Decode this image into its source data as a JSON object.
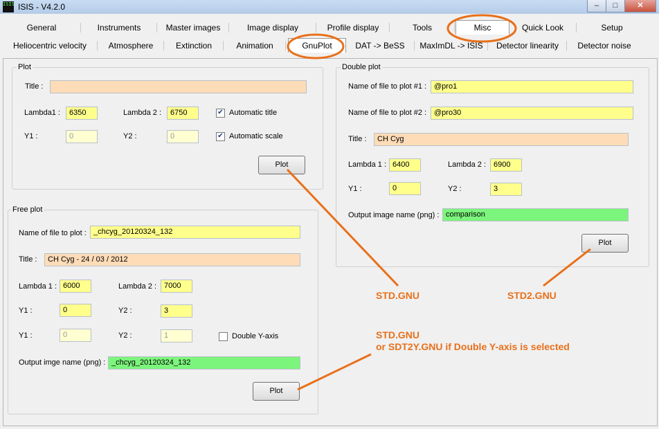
{
  "window": {
    "title": "ISIS - V4.2.0",
    "app_icon": "ISIS",
    "controls": [
      "–",
      "□",
      "✕"
    ]
  },
  "tabs_row1": [
    "General",
    "Instruments",
    "Master images",
    "Image display",
    "Profile display",
    "Tools",
    "Misc",
    "Quick Look",
    "Setup"
  ],
  "tabs_row2": [
    "Heliocentric velocity",
    "Atmosphere",
    "Extinction",
    "Animation",
    "GnuPlot",
    "DAT -> BeSS",
    "MaxImDL -> ISIS",
    "Detector linearity",
    "Detector noise"
  ],
  "plot": {
    "group": "Plot",
    "title_label": "Title :",
    "title_value": "",
    "lambda1_label": "Lambda1 :",
    "lambda1": "6350",
    "lambda2_label": "Lambda 2 :",
    "lambda2": "6750",
    "auto_title_label": "Automatic title",
    "y1_label": "Y1 :",
    "y1": "0",
    "y2_label": "Y2 :",
    "y2": "0",
    "auto_scale_label": "Automatic scale",
    "plot_button": "Plot"
  },
  "free_plot": {
    "group": "Free plot",
    "file_label": "Name of file to plot :",
    "file": "_chcyg_20120324_132",
    "title_label": "Title :",
    "title": "CH Cyg - 24 / 03 / 2012",
    "lambda1_label": "Lambda 1 :",
    "lambda1": "6000",
    "lambda2_label": "Lambda 2 :",
    "lambda2": "7000",
    "y1_label": "Y1 :",
    "y1": "0",
    "y2_label": "Y2 :",
    "y2": "3",
    "y1b_label": "Y1 :",
    "y1b": "0",
    "y2b_label": "Y2 :",
    "y2b": "1",
    "double_y_label": "Double Y-axis",
    "output_label": "Output imge name (png) :",
    "output": "_chcyg_20120324_132",
    "plot_button": "Plot"
  },
  "double_plot": {
    "group": "Double plot",
    "file1_label": "Name of file to plot #1 :",
    "file1": "@pro1",
    "file2_label": "Name of file to plot #2 :",
    "file2": "@pro30",
    "title_label": "Title :",
    "title": "CH Cyg",
    "lambda1_label": "Lambda 1 :",
    "lambda1": "6400",
    "lambda2_label": "Lambda 2 :",
    "lambda2": "6900",
    "y1_label": "Y1 :",
    "y1": "0",
    "y2_label": "Y2 :",
    "y2": "3",
    "output_label": "Output image name (png) :",
    "output": "comparison",
    "plot_button": "Plot"
  },
  "annotations": {
    "std": "STD.GNU",
    "std2": "STD2.GNU",
    "free_line1": "STD.GNU",
    "free_line2": "or SDT2Y.GNU if Double Y-axis is selected",
    "color": "#e8701a"
  }
}
